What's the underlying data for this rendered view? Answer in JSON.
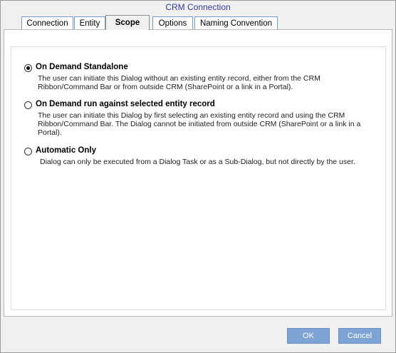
{
  "window": {
    "title": "CRM Connection"
  },
  "tabs": [
    {
      "label": "Connection"
    },
    {
      "label": "Entity"
    },
    {
      "label": "Scope",
      "active": true
    },
    {
      "label": "Options"
    },
    {
      "label": "Naming Convention"
    }
  ],
  "scope_options": [
    {
      "label": "On Demand Standalone",
      "selected": true,
      "description": "The user can initiate this Dialog without an existing entity record, either from the CRM Ribbon/Command Bar or from outside CRM (SharePoint or a link in a Portal)."
    },
    {
      "label": "On Demand run against selected entity record",
      "selected": false,
      "description": "The user can initiate this Dialog by first selecting an existing entity record and using the CRM Ribbon/Command Bar. The Dialog cannot be initiated from outside CRM (SharePoint or a link in a Portal)."
    },
    {
      "label": "Automatic Only",
      "selected": false,
      "description": "Dialog can only be executed from a Dialog Task or as a Sub-Dialog, but not directly by the user."
    }
  ],
  "buttons": {
    "ok": "OK",
    "cancel": "Cancel"
  },
  "colors": {
    "button_bg": "#7ea4d6",
    "title_text": "#3b3b9a",
    "tab_border": "#7a9ac9"
  }
}
